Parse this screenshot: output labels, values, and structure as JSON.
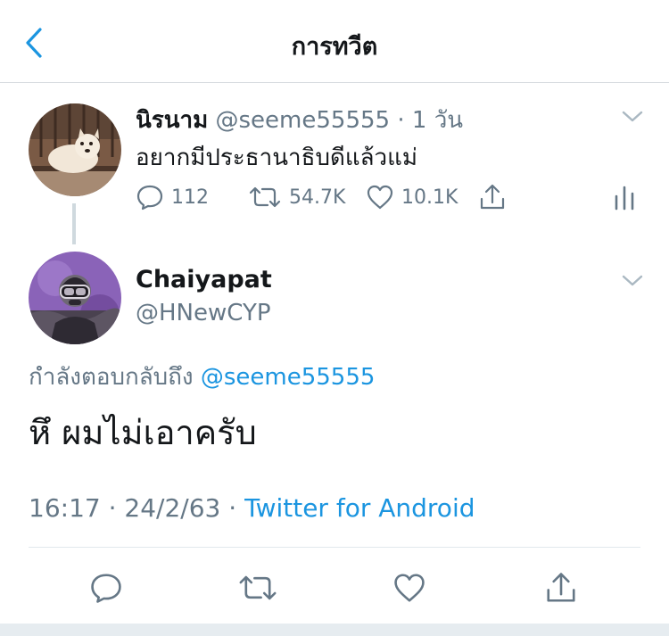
{
  "nav": {
    "title": "การทวีต",
    "back_icon": "chevron-left-icon"
  },
  "parent_tweet": {
    "name": "นิรนาม",
    "handle": "@seeme55555",
    "separator": "·",
    "time": "1 วัน",
    "text": "อยากมีประธานาธิบดีแล้วแม่",
    "replies": "112",
    "retweets": "54.7K",
    "likes": "10.1K"
  },
  "main_tweet": {
    "name": "Chaiyapat",
    "handle": "@HNewCYP",
    "reply_prefix": "กำลังตอบกลับถึง",
    "reply_to": "@seeme55555",
    "text": "หึ ผมไม่เอาครับ",
    "time": "16:17",
    "separator": "·",
    "date": "24/2/63",
    "source": "Twitter for Android"
  },
  "colors": {
    "accent": "#1b95e0",
    "text": "#14171a",
    "secondary": "#657786",
    "divider": "#e1e8ed"
  }
}
